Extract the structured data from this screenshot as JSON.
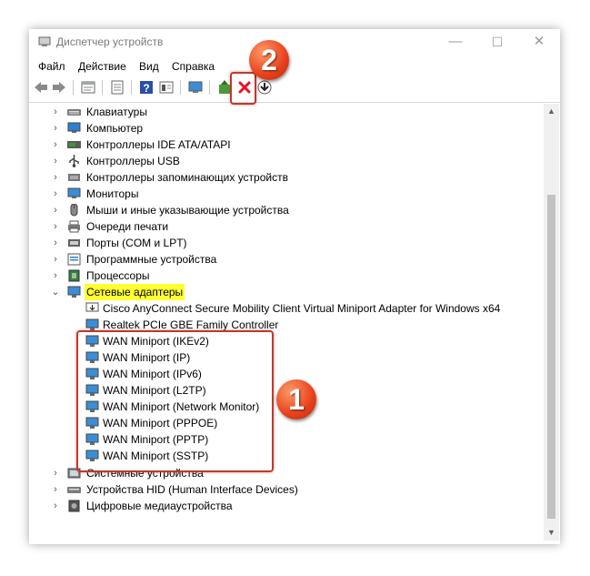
{
  "window": {
    "title": "Диспетчер устройств",
    "controls": {
      "minimize": "—",
      "maximize": "☐",
      "close": "✕"
    }
  },
  "menu": [
    "Файл",
    "Действие",
    "Вид",
    "Справка"
  ],
  "toolbar": {
    "icons": [
      "back-arrow-icon",
      "forward-arrow-icon",
      "properties-icon",
      "list-icon",
      "help-icon",
      "view-icon",
      "monitor-icon",
      "update-driver-icon",
      "uninstall-device-icon",
      "download-driver-icon"
    ],
    "uninstall_color": "#e81123"
  },
  "tree": {
    "categories_top": [
      {
        "label": "Клавиатуры",
        "icon": "keyboard-icon"
      },
      {
        "label": "Компьютер",
        "icon": "computer-icon"
      },
      {
        "label": "Контроллеры IDE ATA/ATAPI",
        "icon": "ide-controller-icon"
      },
      {
        "label": "Контроллеры USB",
        "icon": "usb-icon"
      },
      {
        "label": "Контроллеры запоминающих устройств",
        "icon": "storage-controller-icon"
      },
      {
        "label": "Мониторы",
        "icon": "monitor-icon"
      },
      {
        "label": "Мыши и иные указывающие устройства",
        "icon": "mouse-icon"
      },
      {
        "label": "Очереди печати",
        "icon": "printer-icon"
      },
      {
        "label": "Порты (COM и LPT)",
        "icon": "port-icon"
      },
      {
        "label": "Программные устройства",
        "icon": "software-device-icon"
      },
      {
        "label": "Процессоры",
        "icon": "processor-icon"
      }
    ],
    "expanded": {
      "label": "Сетевые адаптеры",
      "icon": "network-adapter-icon",
      "highlight": "#ffff33"
    },
    "children_normal": [
      {
        "label": "Cisco AnyConnect Secure Mobility Client Virtual Miniport Adapter for Windows x64"
      },
      {
        "label": "Realtek PCIe GBE Family Controller"
      }
    ],
    "children_wan": [
      {
        "label": "WAN Miniport (IKEv2)"
      },
      {
        "label": "WAN Miniport (IP)"
      },
      {
        "label": "WAN Miniport (IPv6)"
      },
      {
        "label": "WAN Miniport (L2TP)"
      },
      {
        "label": "WAN Miniport (Network Monitor)"
      },
      {
        "label": "WAN Miniport (PPPOE)"
      },
      {
        "label": "WAN Miniport (PPTP)"
      },
      {
        "label": "WAN Miniport (SSTP)"
      }
    ],
    "categories_bottom": [
      {
        "label": "Системные устройства",
        "icon": "system-device-icon"
      },
      {
        "label": "Устройства HID (Human Interface Devices)",
        "icon": "hid-icon"
      },
      {
        "label": "Цифровые медиаустройства",
        "icon": "media-device-icon"
      }
    ]
  },
  "annotations": {
    "badge1": "1",
    "badge2": "2",
    "color": "#c0392b"
  }
}
